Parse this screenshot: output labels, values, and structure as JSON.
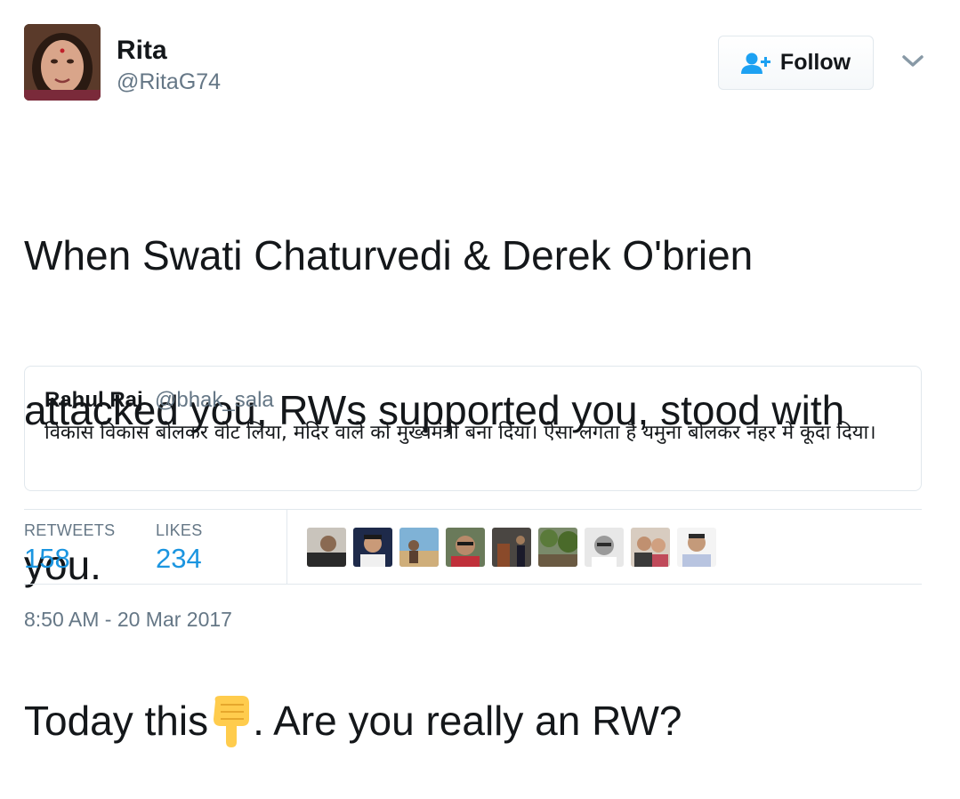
{
  "author": {
    "name": "Rita",
    "handle": "@RitaG74"
  },
  "follow_button": {
    "label": "Follow",
    "icon": "add-person-icon"
  },
  "menu": {
    "icon": "chevron-down-icon"
  },
  "tweet": {
    "lines": [
      "When Swati Chaturvedi & Derek O'brien",
      "attacked you, RWs supported you, stood with",
      "you."
    ],
    "last_line_before_emoji": "Today this",
    "emoji": "pointing-down-emoji",
    "last_line_after_emoji": ". Are you really an RW?"
  },
  "quoted_tweet": {
    "name": "Rahul Raj",
    "handle": "@bhak_sala",
    "text": "विकास विकास बोलकर वोट लिया, मंदिर वाले को मुख्यमंत्री बना दिया। ऐसा लगता है यमुना बोलकर नहर में कूदा दिया।"
  },
  "stats": {
    "retweets_label": "RETWEETS",
    "retweets_value": "158",
    "likes_label": "LIKES",
    "likes_value": "234"
  },
  "likers": [
    {
      "icon": "liker-avatar-1"
    },
    {
      "icon": "liker-avatar-2"
    },
    {
      "icon": "liker-avatar-3"
    },
    {
      "icon": "liker-avatar-4"
    },
    {
      "icon": "liker-avatar-5"
    },
    {
      "icon": "liker-avatar-6"
    },
    {
      "icon": "liker-avatar-7"
    },
    {
      "icon": "liker-avatar-8"
    },
    {
      "icon": "liker-avatar-9"
    }
  ],
  "timestamp": "8:50 AM - 20 Mar 2017",
  "colors": {
    "link_blue": "#1b95e0",
    "follow_icon_blue": "#1da1f2",
    "secondary_text": "#657786",
    "border": "#e1e8ed",
    "emoji_yellow": "#ffcc4d"
  }
}
